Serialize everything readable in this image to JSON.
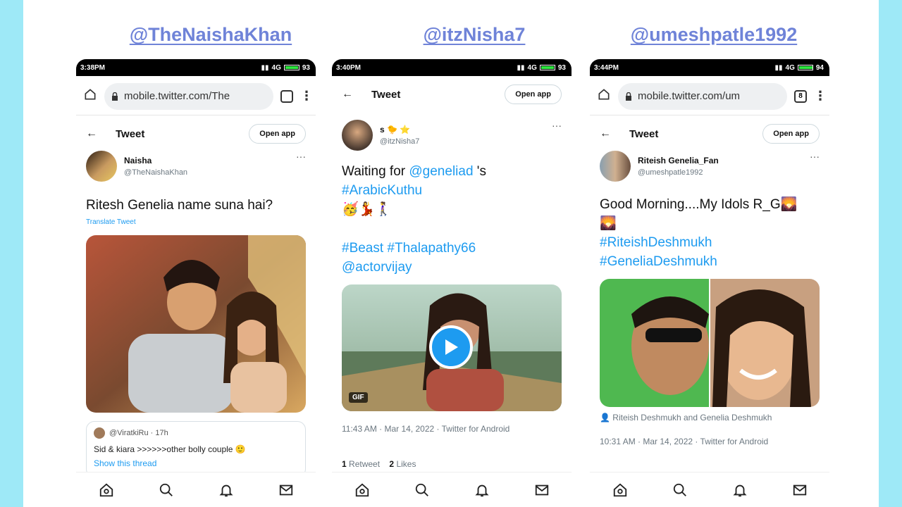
{
  "panels": [
    {
      "handle": "@TheNaishaKhan",
      "status_time": "3:38PM",
      "status_right": "4G",
      "battery": "93",
      "url": "mobile.twitter.com/The",
      "tab_count": "",
      "page_title": "Tweet",
      "open_app": "Open app",
      "author_name": "Naisha",
      "author_handle": "@TheNaishaKhan",
      "text": "Ritesh Genelia name suna hai?",
      "translate": "Translate Tweet",
      "quote": {
        "user": "@ViratkiRu · 17h",
        "text": "Sid & kiara >>>>>>other bolly couple 🙂",
        "link": "Show this thread"
      }
    },
    {
      "handle": "@itzNisha7",
      "status_time": "3:40PM",
      "status_right": "4G",
      "battery": "93",
      "page_title": "Tweet",
      "open_app": "Open app",
      "author_name": "s 🐤 ⭐",
      "author_handle": "@itzNisha7",
      "text_line1": "Waiting for ",
      "mention": "@geneliad",
      "text_line1_end": " 's",
      "hashtag1": "#ArabicKuthu",
      "emojis": "🥳💃🚶‍♀️",
      "hashtags2": "#Beast #Thalapathy66",
      "mention2": "@actorvijay",
      "gif_label": "GIF",
      "timestamp": "11:43 AM · Mar 14, 2022 · Twitter for Android",
      "retweet_count": "1",
      "retweet_label": "Retweet",
      "likes_count": "2",
      "likes_label": "Likes"
    },
    {
      "handle": "@umeshpatle1992",
      "status_time": "3:44PM",
      "status_right": "4G",
      "battery": "94",
      "url": "mobile.twitter.com/um",
      "tab_count": "8",
      "page_title": "Tweet",
      "open_app": "Open app",
      "author_name": "Riteish Genelia_Fan",
      "author_handle": "@umeshpatle1992",
      "text": "Good Morning....My Idols R_G🌄",
      "emoji2": "🌄",
      "hashtag1": "#RiteishDeshmukh",
      "hashtag2": "#GeneliaDeshmukh",
      "tagged": "Riteish Deshmukh and Genelia Deshmukh",
      "timestamp": "10:31 AM · Mar 14, 2022 · Twitter for Android"
    }
  ],
  "colors": {
    "background": "#9ee9f7",
    "handle": "#6f83d8",
    "link": "#1d9bf0"
  },
  "icons": [
    "home-icon",
    "search-icon",
    "bell-icon",
    "mail-icon"
  ]
}
